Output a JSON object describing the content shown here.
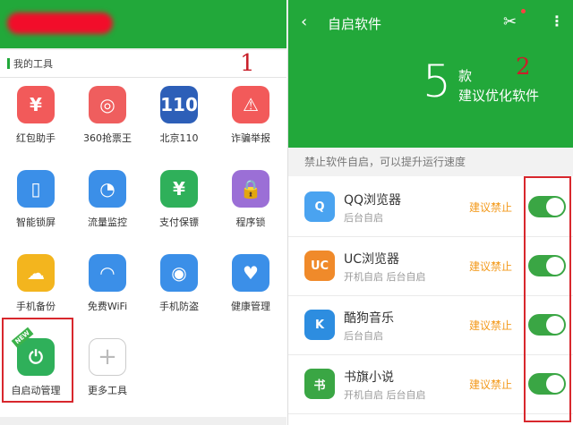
{
  "annotations": {
    "one": "1",
    "two": "2"
  },
  "left_panel": {
    "section_title": "我的工具",
    "tools": [
      {
        "label": "红包助手",
        "icon": "red-envelope-icon",
        "glyph": "¥",
        "color": "#f25a5a"
      },
      {
        "label": "360抢票王",
        "icon": "ticket-icon",
        "glyph": "◎",
        "color": "#ef5e5e"
      },
      {
        "label": "北京110",
        "icon": "police-badge-icon",
        "glyph": "110",
        "color": "#2d5fb8"
      },
      {
        "label": "诈骗举报",
        "icon": "alarm-icon",
        "glyph": "⚠",
        "color": "#f25a5a"
      },
      {
        "label": "智能锁屏",
        "icon": "lock-screen-icon",
        "glyph": "▯",
        "color": "#3b8fe8"
      },
      {
        "label": "流量监控",
        "icon": "data-monitor-icon",
        "glyph": "◔",
        "color": "#3b8fe8"
      },
      {
        "label": "支付保镖",
        "icon": "payment-shield-icon",
        "glyph": "¥",
        "color": "#2fb05a"
      },
      {
        "label": "程序锁",
        "icon": "app-lock-icon",
        "glyph": "🔒",
        "color": "#9b6fd6"
      },
      {
        "label": "手机备份",
        "icon": "cloud-backup-icon",
        "glyph": "☁",
        "color": "#f3b51e"
      },
      {
        "label": "免费WiFi",
        "icon": "wifi-icon",
        "glyph": "◠",
        "color": "#3b8fe8"
      },
      {
        "label": "手机防盗",
        "icon": "anti-theft-icon",
        "glyph": "◉",
        "color": "#3b8fe8"
      },
      {
        "label": "健康管理",
        "icon": "health-icon",
        "glyph": "♥",
        "color": "#3b8fe8"
      },
      {
        "label": "自启动管理",
        "icon": "power-icon",
        "glyph": "⏻",
        "color": "#2fb05a",
        "badge": "NEW"
      },
      {
        "label": "更多工具",
        "icon": "plus-icon",
        "glyph": "+",
        "color": "#ffffff"
      }
    ]
  },
  "right_panel": {
    "title": "自启软件",
    "count": "5",
    "count_unit": "款",
    "count_sub": "建议优化软件",
    "hint": "禁止软件自启，可以提升运行速度",
    "apps": [
      {
        "name": "QQ浏览器",
        "sub": "后台自启",
        "advice": "建议禁止",
        "icon": "qq-browser-icon",
        "glyph": "Q",
        "color": "#4aa3f0"
      },
      {
        "name": "UC浏览器",
        "sub": "开机自启 后台自启",
        "advice": "建议禁止",
        "icon": "uc-browser-icon",
        "glyph": "UC",
        "color": "#f08a2a"
      },
      {
        "name": "酷狗音乐",
        "sub": "后台自启",
        "advice": "建议禁止",
        "icon": "kugou-icon",
        "glyph": "K",
        "color": "#2d8de0"
      },
      {
        "name": "书旗小说",
        "sub": "开机自启 后台自启",
        "advice": "建议禁止",
        "icon": "shuqi-icon",
        "glyph": "书",
        "color": "#3aa644"
      }
    ]
  }
}
